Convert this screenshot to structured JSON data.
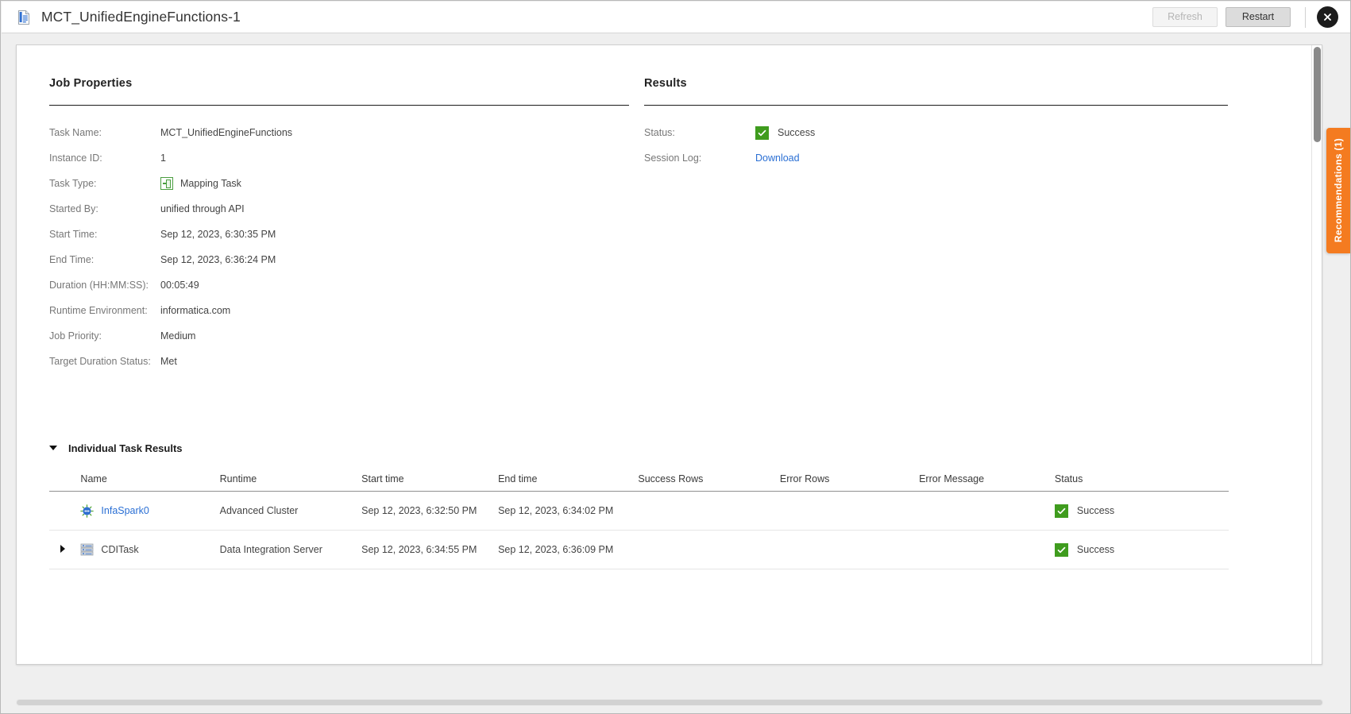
{
  "titlebar": {
    "icon": "document-icon",
    "title": "MCT_UnifiedEngineFunctions-1",
    "refresh_label": "Refresh",
    "restart_label": "Restart",
    "close_icon": "close-icon"
  },
  "job_properties": {
    "heading": "Job Properties",
    "rows": [
      {
        "label": "Task Name:",
        "value": "MCT_UnifiedEngineFunctions"
      },
      {
        "label": "Instance ID:",
        "value": "1"
      },
      {
        "label": "Task Type:",
        "value": "Mapping Task",
        "icon": "mapping-task-icon"
      },
      {
        "label": "Started By:",
        "value": "unified through API"
      },
      {
        "label": "Start Time:",
        "value": "Sep 12, 2023, 6:30:35 PM"
      },
      {
        "label": "End Time:",
        "value": "Sep 12, 2023, 6:36:24 PM"
      },
      {
        "label": "Duration (HH:MM:SS):",
        "value": "00:05:49"
      },
      {
        "label": "Runtime Environment:",
        "value": "informatica.com"
      },
      {
        "label": "Job Priority:",
        "value": "Medium"
      },
      {
        "label": "Target Duration Status:",
        "value": "Met"
      }
    ]
  },
  "results": {
    "heading": "Results",
    "status_label": "Status:",
    "status_value": "Success",
    "status_icon": "success-check-icon",
    "session_log_label": "Session Log:",
    "session_log_link": "Download"
  },
  "individual_task_results": {
    "heading": "Individual Task Results",
    "expanded": true,
    "columns": [
      "Name",
      "Runtime",
      "Start time",
      "End time",
      "Success Rows",
      "Error Rows",
      "Error Message",
      "Status"
    ],
    "rows": [
      {
        "expandable": false,
        "icon": "infaspark-icon",
        "name": "InfaSpark0",
        "name_is_link": true,
        "runtime": "Advanced Cluster",
        "start_time": "Sep 12, 2023, 6:32:50 PM",
        "end_time": "Sep 12, 2023, 6:34:02 PM",
        "success_rows": "",
        "error_rows": "",
        "error_message": "",
        "status": "Success"
      },
      {
        "expandable": true,
        "icon": "cditask-icon",
        "name": "CDITask",
        "name_is_link": false,
        "runtime": "Data Integration Server",
        "start_time": "Sep 12, 2023, 6:34:55 PM",
        "end_time": "Sep 12, 2023, 6:36:09 PM",
        "success_rows": "",
        "error_rows": "",
        "error_message": "",
        "status": "Success"
      }
    ]
  },
  "recommendations_tab": {
    "label": "Recommendations (1)",
    "color": "#f47b20"
  },
  "colors": {
    "link": "#2a6fd4",
    "success_green": "#3f9c1e",
    "accent_orange": "#f47b20"
  }
}
